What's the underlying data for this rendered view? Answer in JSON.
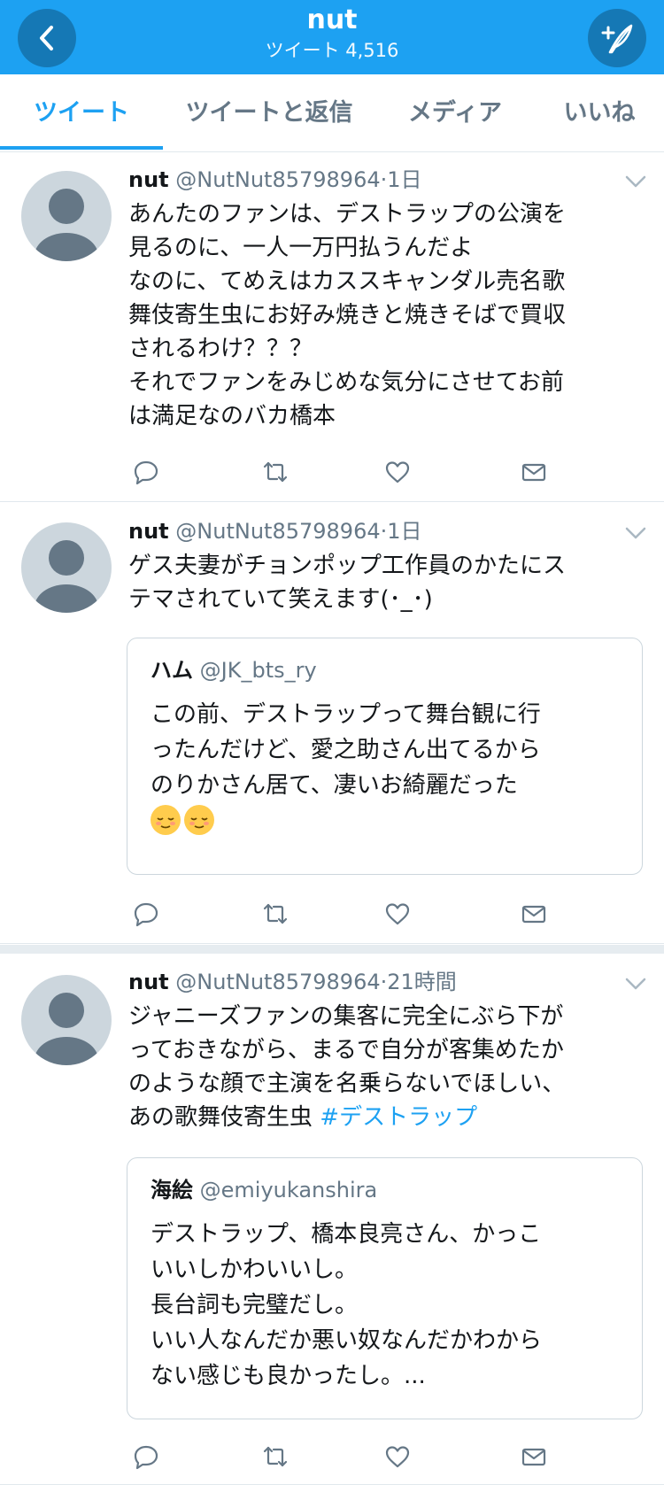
{
  "header": {
    "title": "nut",
    "subtitle": "ツイート 4,516"
  },
  "tabs": [
    {
      "label": "ツイート",
      "active": true
    },
    {
      "label": "ツイートと返信",
      "active": false
    },
    {
      "label": "メディア",
      "active": false
    },
    {
      "label": "いいね",
      "active": false
    }
  ],
  "colors": {
    "brand": "#1da1f2",
    "text": "#14171a",
    "secondary": "#657786",
    "border": "#e1e8ed"
  },
  "tweets": [
    {
      "name": "nut",
      "handle": "@NutNut85798964",
      "time": "1日",
      "text": "あんたのファンは、デストラップの公演を\n見るのに、一人一万円払うんだよ\nなのに、てめえはカススキャンダル売名歌\n舞伎寄生虫にお好み焼きと焼きそばで買収\nされるわけ？？？\nそれでファンをみじめな気分にさせてお前\nは満足なのバカ橋本"
    },
    {
      "name": "nut",
      "handle": "@NutNut85798964",
      "time": "1日",
      "text": "ゲス夫妻がチョンポップ工作員のかたにス\nテマされていて笑えます(･_･)",
      "quote": {
        "name": "ハム",
        "handle": "@JK_bts_ry",
        "text": "この前、デストラップって舞台観に行\nったんだけど、愛之助さん出てるから\nのりかさん居て、凄いお綺麗だった"
      }
    },
    {
      "name": "nut",
      "handle": "@NutNut85798964",
      "time": "21時間",
      "text": "ジャニーズファンの集客に完全にぶら下が\nっておきながら、まるで自分が客集めたか\nのような顔で主演を名乗らないでほしい、\nあの歌舞伎寄生虫",
      "hashtag": "#デストラップ",
      "quote": {
        "name": "海絵",
        "handle": "@emiyukanshira",
        "text": "デストラップ、橋本良亮さん、かっこ\nいいしかわいいし。\n長台詞も完璧だし。\nいい人なんだか悪い奴なんだかわから\nない感じも良かったし。..."
      }
    }
  ],
  "icons": {
    "back": "chevron-left-icon",
    "compose": "compose-tweet-icon",
    "reply": "reply-icon",
    "retweet": "retweet-icon",
    "like": "heart-icon",
    "dm": "envelope-icon",
    "menu": "chevron-down-icon"
  }
}
